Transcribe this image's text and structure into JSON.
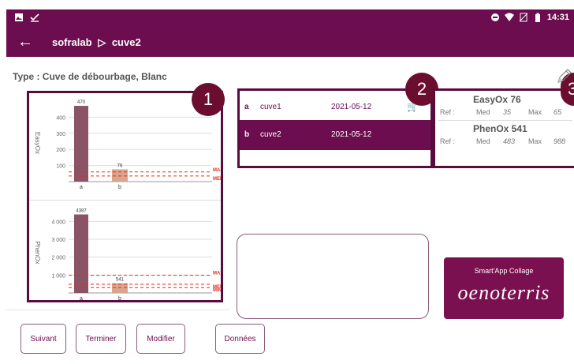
{
  "statusbar": {
    "time": "14:31"
  },
  "appbar": {
    "back_icon": "arrow-left-icon",
    "crumbs": [
      "sofralab",
      "▷",
      "cuve2"
    ]
  },
  "type_title": "Type : Cuve de débourbage, Blanc",
  "badges": [
    "1",
    "2",
    "3"
  ],
  "charts": {
    "easyox": {
      "ylabel": "EasyOx",
      "yticks": [
        "400",
        "300",
        "200",
        "100"
      ],
      "categories": [
        "a",
        "b"
      ],
      "bar_labels": [
        "470",
        "76"
      ],
      "refs": [
        "MAX",
        "MED"
      ]
    },
    "phenox": {
      "ylabel": "PhenOx",
      "yticks": [
        "4 000",
        "3 000",
        "2 000",
        "1 000"
      ],
      "categories": [
        "a",
        "b"
      ],
      "bar_labels": [
        "4387",
        "541"
      ],
      "refs": [
        "MAX",
        "MED",
        "MIN"
      ]
    }
  },
  "chart_data": [
    {
      "type": "bar",
      "title": "",
      "ylabel": "EasyOx",
      "categories": [
        "a",
        "b"
      ],
      "values": [
        470,
        76
      ],
      "ylim": [
        0,
        480
      ],
      "ref_lines": {
        "MAX": 60,
        "MED": 35
      }
    },
    {
      "type": "bar",
      "title": "",
      "ylabel": "PhenOx",
      "categories": [
        "a",
        "b"
      ],
      "values": [
        4387,
        541
      ],
      "ylim": [
        0,
        4500
      ],
      "ref_lines": {
        "MAX": 988,
        "MED": 483,
        "MIN": 300
      }
    }
  ],
  "list": {
    "rows": [
      {
        "idx": "a",
        "name": "cuve1",
        "date": "2021-05-12",
        "icon": "cart-icon"
      },
      {
        "idx": "b",
        "name": "cuve2",
        "date": "2021-05-12"
      }
    ]
  },
  "stats": [
    {
      "title": "EasyOx  76",
      "ref": "Ref :",
      "med": "Med",
      "med_val": "35",
      "max": "Max",
      "max_val": "65"
    },
    {
      "title": "PhenOx  541",
      "ref": "Ref :",
      "med": "Med",
      "med_val": "483",
      "max": "Max",
      "max_val": "988"
    }
  ],
  "logo": {
    "tagline": "Smart'App Collage",
    "brand": "oenoterris"
  },
  "buttons": {
    "next": "Suivant",
    "finish": "Terminer",
    "edit": "Modifier",
    "data": "Données"
  },
  "colors": {
    "primary": "#6b0d4f",
    "bar_a": "#8a5466",
    "bar_b": "#d9a58f",
    "ref": "#e0301e"
  }
}
